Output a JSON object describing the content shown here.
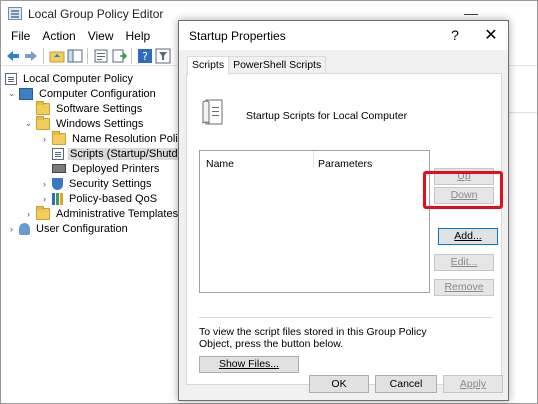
{
  "main_window": {
    "title": "Local Group Policy Editor",
    "controls": {
      "minimize": "—",
      "maximize": "☐",
      "close": "✕"
    }
  },
  "menu": [
    "File",
    "Action",
    "View",
    "Help"
  ],
  "tree": {
    "items": [
      {
        "label": "Local Computer Policy",
        "icon": "policy-icon"
      },
      {
        "label": "Computer Configuration",
        "icon": "computer-icon"
      },
      {
        "label": "Software Settings",
        "icon": "folder-icon"
      },
      {
        "label": "Windows Settings",
        "icon": "folder-icon"
      },
      {
        "label": "Name Resolution Policy",
        "icon": "folder-icon"
      },
      {
        "label": "Scripts (Startup/Shutdown)",
        "icon": "script-icon"
      },
      {
        "label": "Deployed Printers",
        "icon": "printer-icon"
      },
      {
        "label": "Security Settings",
        "icon": "security-icon"
      },
      {
        "label": "Policy-based QoS",
        "icon": "chart-icon"
      },
      {
        "label": "Administrative Templates",
        "icon": "folder-icon"
      },
      {
        "label": "User Configuration",
        "icon": "user-icon"
      }
    ]
  },
  "dialog": {
    "title": "Startup Properties",
    "help": "?",
    "close": "✕",
    "tabs": [
      "Scripts",
      "PowerShell Scripts"
    ],
    "heading": "Startup Scripts for Local Computer",
    "list_columns": [
      "Name",
      "Parameters"
    ],
    "buttons": {
      "up": "Up",
      "down": "Down",
      "add": "Add...",
      "edit": "Edit...",
      "remove": "Remove",
      "show_files": "Show Files...",
      "ok": "OK",
      "cancel": "Cancel",
      "apply": "Apply"
    },
    "info_text": "To view the script files stored in this Group Policy Object, press the button below."
  },
  "colors": {
    "highlight": "#e0101b",
    "focus": "#0078d7"
  }
}
